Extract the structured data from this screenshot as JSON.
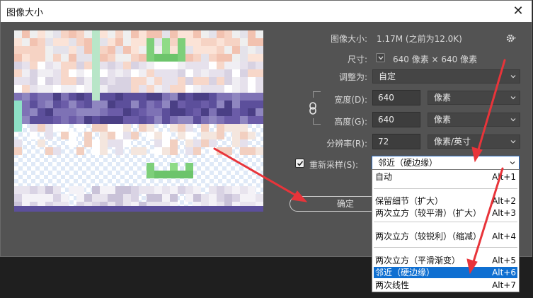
{
  "window": {
    "title": "图像大小",
    "close_glyph": "✕"
  },
  "image_size": {
    "label": "图像大小:",
    "value": "1.17M (之前为12.0K)"
  },
  "dimensions": {
    "label": "尺寸:",
    "value": "640 像素 × 640 像素"
  },
  "fit_to": {
    "label": "调整为:",
    "value": "自定"
  },
  "width": {
    "label": "宽度(D):",
    "value": "640",
    "unit": "像素"
  },
  "height": {
    "label": "高度(G):",
    "value": "640",
    "unit": "像素"
  },
  "resolution": {
    "label": "分辨率(R):",
    "value": "72",
    "unit": "像素/英寸"
  },
  "resample": {
    "label": "重新采样(S):",
    "checked": true,
    "selected": "邻近（硬边缘）",
    "options": [
      {
        "label": "自动",
        "shortcut": "Alt+1"
      },
      {
        "label": "保留细节（扩大）",
        "shortcut": "Alt+2"
      },
      {
        "label": "两次立方（较平滑）（扩大）",
        "shortcut": "Alt+3"
      },
      {
        "label": "两次立方（较锐利）（缩减）",
        "shortcut": "Alt+4"
      },
      {
        "label": "两次立方（平滑渐变）",
        "shortcut": "Alt+5"
      },
      {
        "label": "邻近（硬边缘）",
        "shortcut": "Alt+6"
      },
      {
        "label": "两次线性",
        "shortcut": "Alt+7"
      }
    ]
  },
  "buttons": {
    "ok": "确定"
  },
  "colors": {
    "accent": "#0f6fd1",
    "arrow": "#e8343a",
    "dialog_bg": "#535353"
  }
}
